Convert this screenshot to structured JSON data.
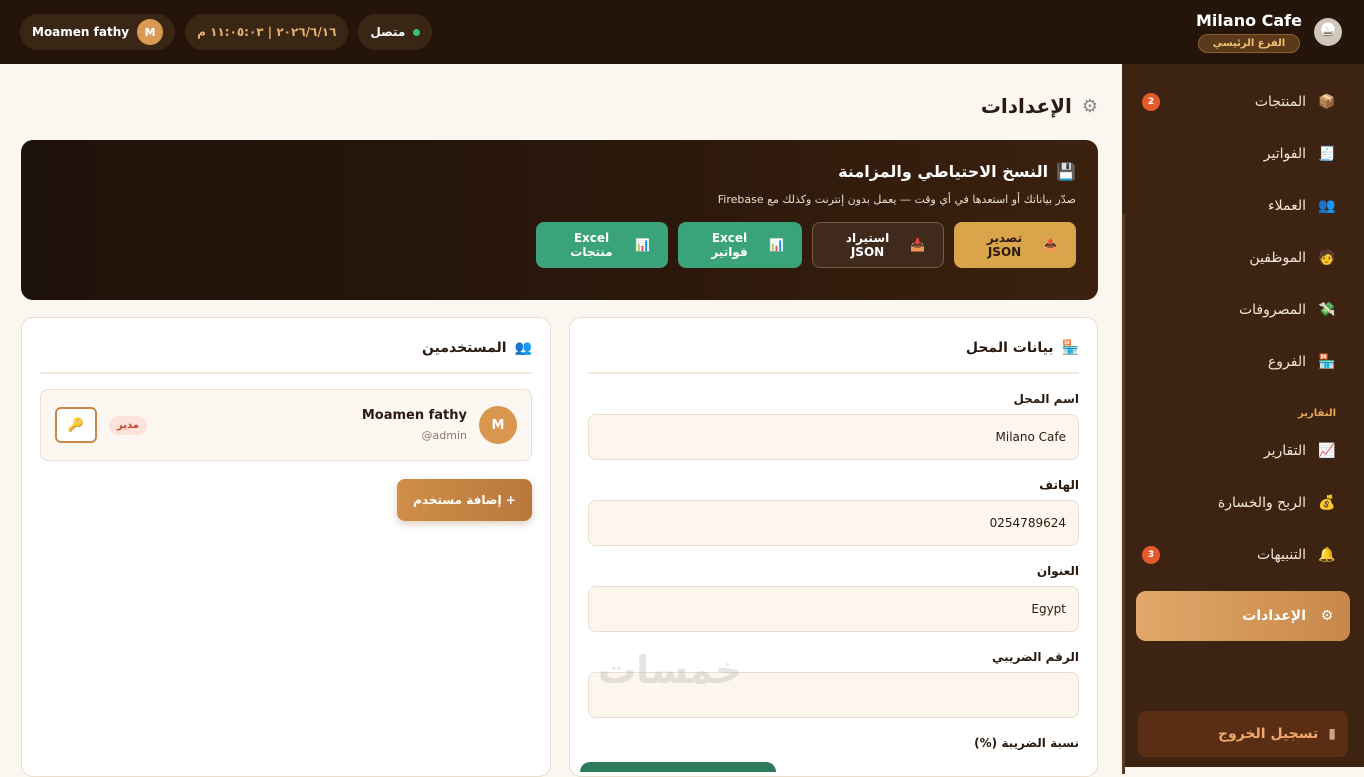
{
  "header": {
    "brand_name": "Milano Cafe",
    "branch": "الفرع الرئيسي",
    "user_name": "Moamen fathy",
    "user_initial": "M",
    "datetime": "٢٠٢٦/٦/١٦ | ١١:٠٥:٠٣ م",
    "status": "متصل"
  },
  "sidebar": {
    "items": [
      {
        "label": "المنتجات",
        "icon": "📦",
        "badge": "2"
      },
      {
        "label": "الفواتير",
        "icon": "🧾",
        "badge": ""
      },
      {
        "label": "العملاء",
        "icon": "👥",
        "badge": ""
      },
      {
        "label": "الموظفين",
        "icon": "🧑",
        "badge": ""
      },
      {
        "label": "المصروفات",
        "icon": "💸",
        "badge": ""
      },
      {
        "label": "الفروع",
        "icon": "🏪",
        "badge": ""
      }
    ],
    "section_reports": "التقارير",
    "report_items": [
      {
        "label": "التقارير",
        "icon": "📈",
        "badge": ""
      },
      {
        "label": "الربح والخسارة",
        "icon": "💰",
        "badge": ""
      },
      {
        "label": "التنبيهات",
        "icon": "🔔",
        "badge": "3"
      }
    ],
    "active_item": {
      "label": "الإعدادات",
      "icon": "⚙"
    },
    "logout": "تسجيل الخروج"
  },
  "page": {
    "title": "الإعدادات"
  },
  "backup": {
    "title": "النسخ الاحتياطي والمزامنة",
    "description": "صدّر بياناتك أو استعدها في أي وقت — يعمل بدون إنترنت وكذلك مع Firebase",
    "export_json": "تصدير JSON",
    "import_json": "استيراد JSON",
    "excel_invoices": "Excel فواتير",
    "excel_products": "Excel منتجات"
  },
  "shop": {
    "title": "بيانات المحل",
    "name_label": "اسم المحل",
    "name_value": "Milano Cafe",
    "phone_label": "الهاتف",
    "phone_value": "0254789624",
    "address_label": "العنوان",
    "address_value": "Egypt",
    "tax_number_label": "الرقم الضريبي",
    "tax_number_value": "",
    "tax_rate_label": "نسبة الضريبة (%)"
  },
  "users": {
    "title": "المستخدمين",
    "list": [
      {
        "initial": "M",
        "name": "Moamen fathy",
        "handle": "admin@",
        "role": "مدير"
      }
    ],
    "add_button": "+ إضافة مستخدم"
  },
  "watermark": "خمسات"
}
